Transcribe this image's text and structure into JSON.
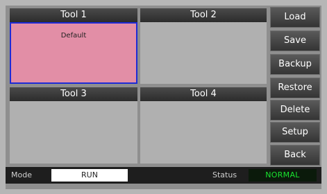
{
  "tools": [
    {
      "title": "Tool 1",
      "body_label": "Default",
      "selected": true
    },
    {
      "title": "Tool 2",
      "body_label": "",
      "selected": false
    },
    {
      "title": "Tool 3",
      "body_label": "",
      "selected": false
    },
    {
      "title": "Tool 4",
      "body_label": "",
      "selected": false
    }
  ],
  "side_buttons": [
    "Load",
    "Save",
    "Backup",
    "Restore",
    "Delete",
    "Setup",
    "Back"
  ],
  "statusbar": {
    "mode_label": "Mode",
    "mode_value": "RUN",
    "status_label": "Status",
    "status_value": "NORMAL"
  },
  "colors": {
    "selected_fill": "#e28ea6",
    "selected_border": "#1d2ad6",
    "status_ok": "#19e32f"
  }
}
